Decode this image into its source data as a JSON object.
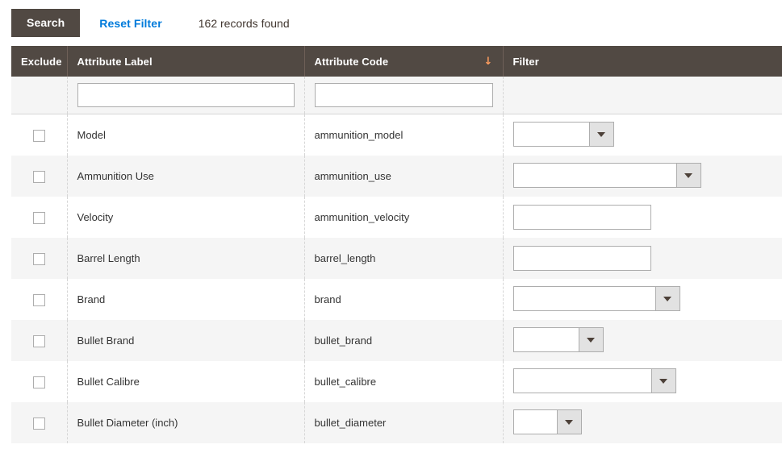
{
  "toolbar": {
    "search_label": "Search",
    "reset_label": "Reset Filter",
    "records_found": "162 records found"
  },
  "colors": {
    "header_bg": "#514943",
    "button_bg": "#514943",
    "link": "#007bdb",
    "sort_arrow": "#ff9d5e",
    "row_alt_bg": "#f5f5f5",
    "border": "#adadad"
  },
  "grid": {
    "columns": [
      {
        "key": "exclude",
        "label": "Exclude",
        "sorted": false,
        "sort_arrow": ""
      },
      {
        "key": "attribute_label",
        "label": "Attribute Label",
        "sorted": false,
        "sort_arrow": ""
      },
      {
        "key": "attribute_code",
        "label": "Attribute Code",
        "sorted": true,
        "sort_arrow": "↓"
      },
      {
        "key": "filter",
        "label": "Filter",
        "sorted": false,
        "sort_arrow": ""
      }
    ],
    "filter_row": {
      "attribute_label_value": "",
      "attribute_label_placeholder": "",
      "attribute_code_value": "",
      "attribute_code_placeholder": ""
    },
    "rows": [
      {
        "exclude_checked": false,
        "attribute_label": "Model",
        "attribute_code": "ammunition_model",
        "filter_type": "select",
        "filter_value": "",
        "filter_width": 125
      },
      {
        "exclude_checked": false,
        "attribute_label": "Ammunition Use",
        "attribute_code": "ammunition_use",
        "filter_type": "select",
        "filter_value": "",
        "filter_width": 233
      },
      {
        "exclude_checked": false,
        "attribute_label": "Velocity",
        "attribute_code": "ammunition_velocity",
        "filter_type": "text",
        "filter_value": "",
        "filter_width": 171
      },
      {
        "exclude_checked": false,
        "attribute_label": "Barrel Length",
        "attribute_code": "barrel_length",
        "filter_type": "text",
        "filter_value": "",
        "filter_width": 171
      },
      {
        "exclude_checked": false,
        "attribute_label": "Brand",
        "attribute_code": "brand",
        "filter_type": "select",
        "filter_value": "",
        "filter_width": 207
      },
      {
        "exclude_checked": false,
        "attribute_label": "Bullet Brand",
        "attribute_code": "bullet_brand",
        "filter_type": "select",
        "filter_value": "",
        "filter_width": 112
      },
      {
        "exclude_checked": false,
        "attribute_label": "Bullet Calibre",
        "attribute_code": "bullet_calibre",
        "filter_type": "select",
        "filter_value": "",
        "filter_width": 202
      },
      {
        "exclude_checked": false,
        "attribute_label": "Bullet Diameter (inch)",
        "attribute_code": "bullet_diameter",
        "filter_type": "select",
        "filter_value": "",
        "filter_width": 85
      }
    ]
  }
}
